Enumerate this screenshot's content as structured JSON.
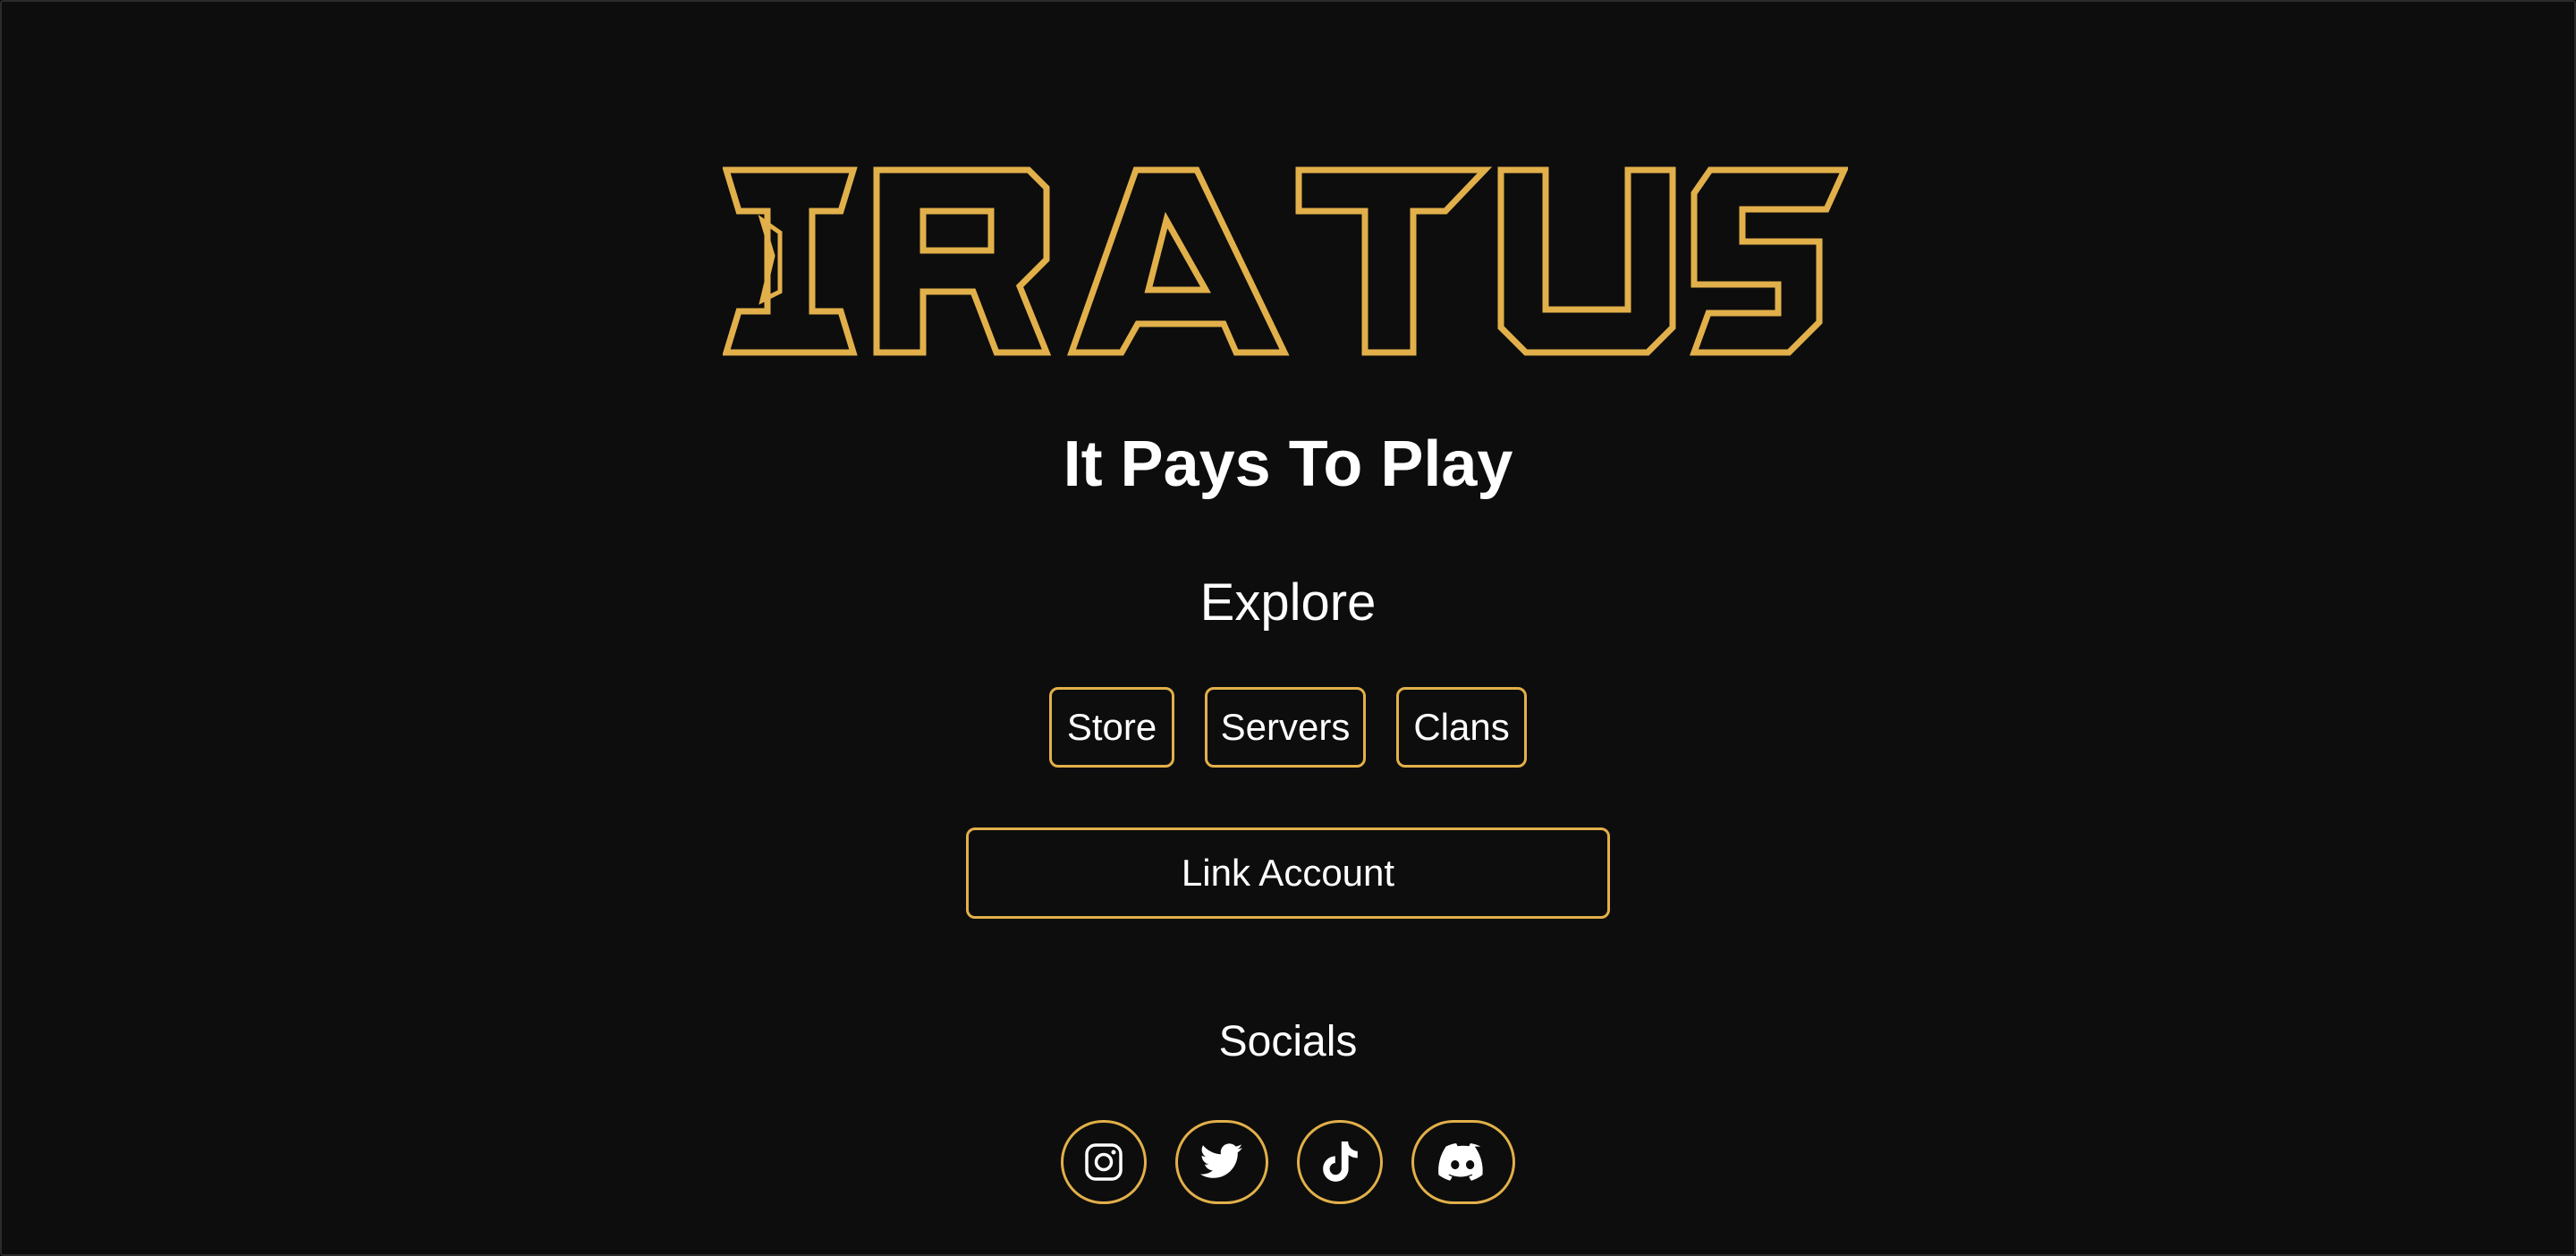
{
  "brand": {
    "logo_text": "IRATUS",
    "tagline": "It Pays To Play",
    "accent_color": "#e2b04a",
    "background_color": "#0d0d0d"
  },
  "explore": {
    "heading": "Explore",
    "buttons": [
      {
        "label": "Store"
      },
      {
        "label": "Servers"
      },
      {
        "label": "Clans"
      }
    ],
    "link_account_label": "Link Account"
  },
  "socials": {
    "heading": "Socials",
    "icons": [
      "instagram-icon",
      "twitter-icon",
      "tiktok-icon",
      "discord-icon"
    ]
  }
}
